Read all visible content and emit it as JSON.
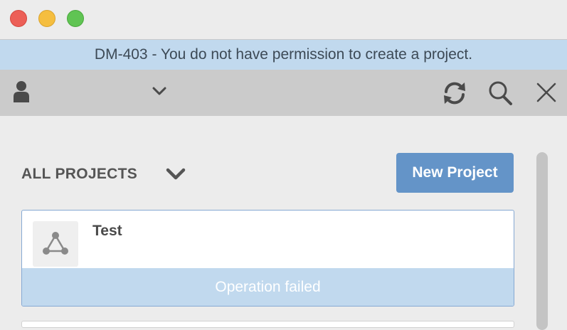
{
  "window": {
    "controls": [
      "close",
      "minimize",
      "zoom"
    ]
  },
  "banner": {
    "message": "DM-403 - You do not have permission to create a project."
  },
  "toolbar": {
    "icons": [
      "user-icon",
      "chevron-down-icon",
      "refresh-icon",
      "search-icon",
      "close-icon"
    ]
  },
  "projects": {
    "heading": "ALL PROJECTS",
    "new_project_label": "New Project",
    "items": [
      {
        "name": "Test",
        "icon": "project-graph-icon",
        "status": "Operation failed"
      }
    ]
  },
  "colors": {
    "banner_bg": "#c1d9ee",
    "accent": "#6494c8",
    "toolbar_bg": "#cbcbcb"
  }
}
